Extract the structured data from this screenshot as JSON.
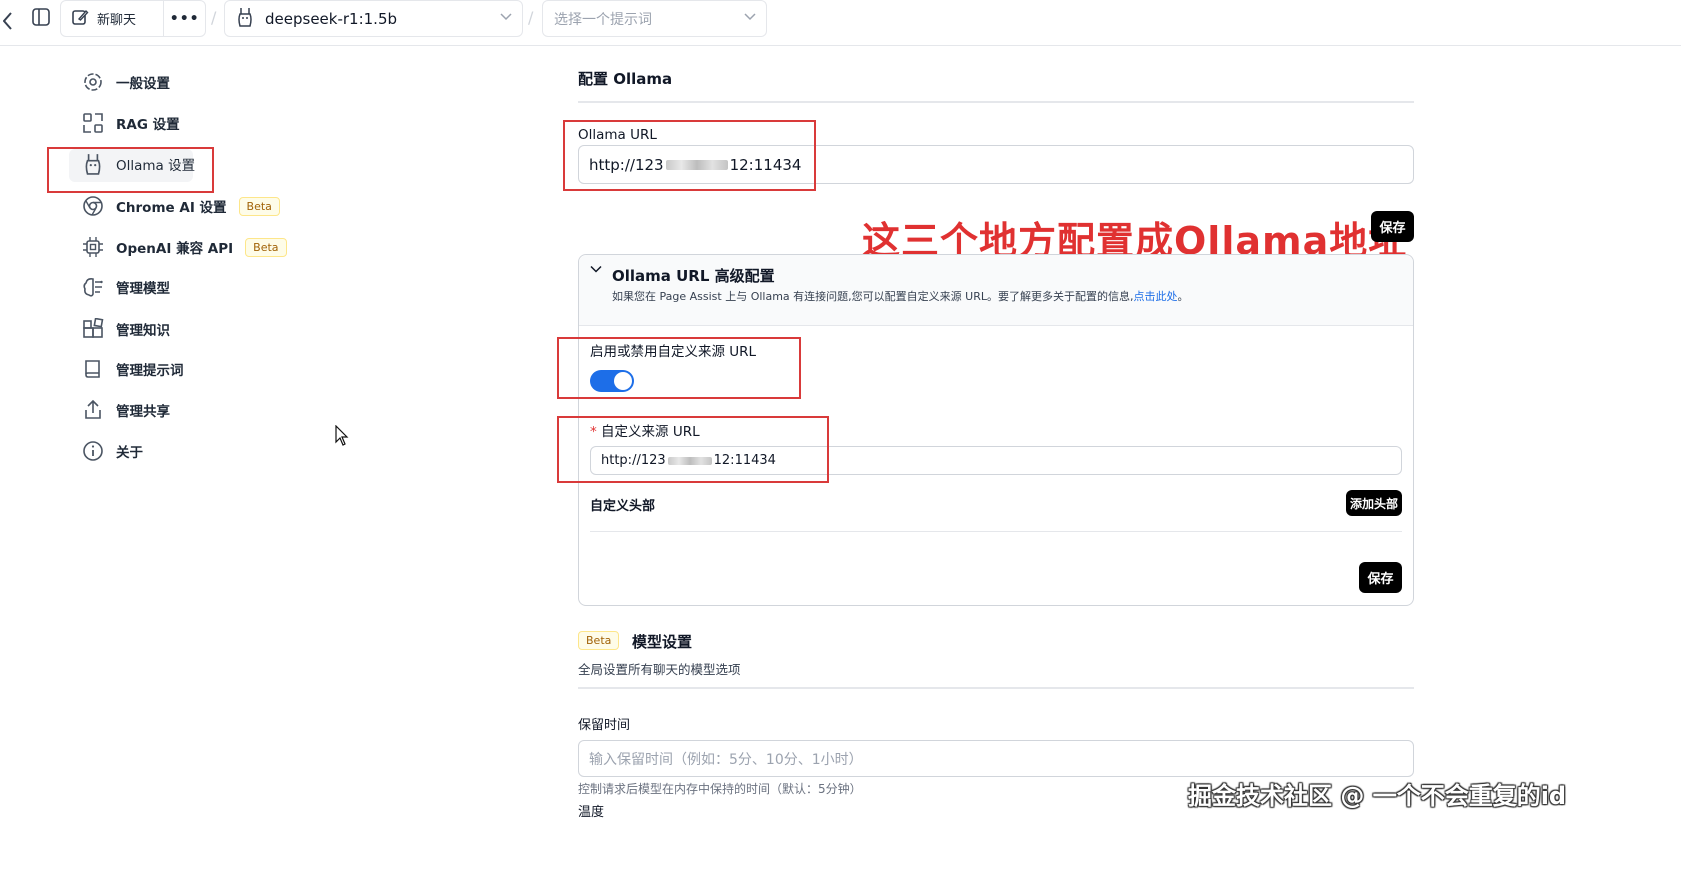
{
  "topbar": {
    "new_chat_label": "新聊天",
    "model_name": "deepseek-r1:1.5b",
    "prompt_placeholder": "选择一个提示词",
    "separator": "/"
  },
  "sidebar": {
    "items": [
      {
        "label": "一般设置",
        "icon": "gear-icon"
      },
      {
        "label": "RAG 设置",
        "icon": "scan-icon"
      },
      {
        "label": "Ollama 设置",
        "icon": "llama-icon",
        "active": true
      },
      {
        "label": "Chrome AI 设置",
        "icon": "chrome-icon",
        "badge": "Beta"
      },
      {
        "label": "OpenAI 兼容 API",
        "icon": "chip-icon",
        "badge": "Beta"
      },
      {
        "label": "管理模型",
        "icon": "brain-icon"
      },
      {
        "label": "管理知识",
        "icon": "blocks-icon"
      },
      {
        "label": "管理提示词",
        "icon": "book-icon"
      },
      {
        "label": "管理共享",
        "icon": "share-icon"
      },
      {
        "label": "关于",
        "icon": "info-icon"
      }
    ]
  },
  "main": {
    "section_title": "配置 Ollama",
    "ollama_url": {
      "label": "Ollama URL",
      "value_prefix": "http://123",
      "value_suffix": "12:11434"
    },
    "save_label": "保存",
    "annotation": "这三个地方配置成Ollama地址",
    "advanced": {
      "title": "Ollama URL 高级配置",
      "description": "如果您在 Page Assist 上与 Ollama 有连接问题,您可以配置自定义来源 URL。要了解更多关于配置的信息,",
      "link": "点击此处",
      "description_end": "。",
      "toggle_label": "启用或禁用自定义来源 URL",
      "toggle_on": true,
      "required_mark": "*",
      "origin_label": "自定义来源 URL",
      "origin_prefix": "http://123",
      "origin_suffix": "12:11434",
      "headers_label": "自定义头部",
      "add_header_label": "添加头部",
      "save_label": "保存"
    },
    "model_settings": {
      "badge": "Beta",
      "title": "模型设置",
      "subtitle": "全局设置所有聊天的模型选项",
      "keep_alive_label": "保留时间",
      "keep_alive_placeholder": "输入保留时间（例如：5分、10分、1小时）",
      "keep_alive_help": "控制请求后模型在内存中保持的时间（默认：5分钟）",
      "temperature_label": "温度"
    }
  },
  "watermark": "掘金技术社区 @ 一个不会重复的id",
  "colors": {
    "accent": "#1d6ee8",
    "annotation_red": "#e03131",
    "beta_bg": "#fefce8"
  }
}
